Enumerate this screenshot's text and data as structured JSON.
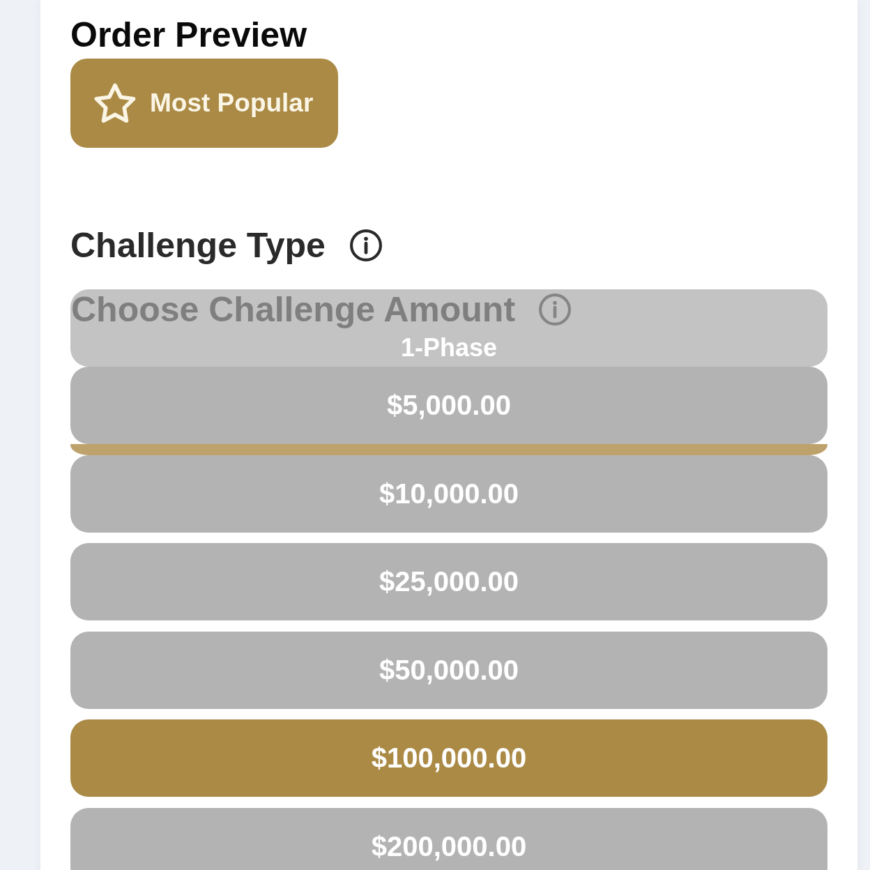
{
  "title": "Order Preview",
  "badge": {
    "label": "Most Popular"
  },
  "challenge_type": {
    "heading": "Challenge Type",
    "options": [
      {
        "label": "1-Phase",
        "selected": false
      },
      {
        "selected": true
      }
    ]
  },
  "challenge_amount": {
    "heading": "Choose Challenge Amount",
    "options": [
      {
        "label": "$5,000.00",
        "selected": false
      },
      {
        "label": "$10,000.00",
        "selected": false
      },
      {
        "label": "$25,000.00",
        "selected": false
      },
      {
        "label": "$50,000.00",
        "selected": false
      },
      {
        "label": "$100,000.00",
        "selected": true
      },
      {
        "label": "$200,000.00",
        "selected": false
      }
    ]
  }
}
